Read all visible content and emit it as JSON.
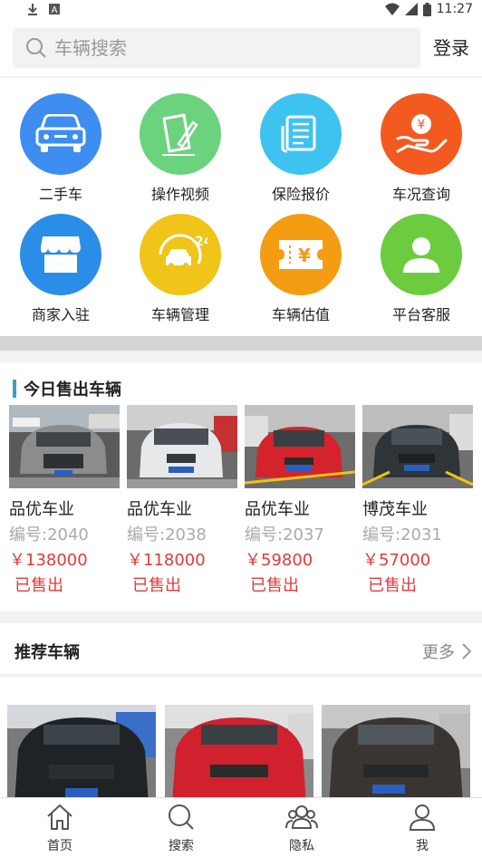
{
  "status_bar": {
    "time": "11:27",
    "icons": [
      "download-icon",
      "notification-a-icon",
      "wifi-icon",
      "signal-icon",
      "battery-icon"
    ]
  },
  "search": {
    "placeholder": "车辆搜索",
    "login_label": "登录"
  },
  "grid": [
    {
      "label": "二手车",
      "icon": "car-front-icon",
      "color": "#3d8ef0"
    },
    {
      "label": "操作视频",
      "icon": "document-pen-icon",
      "color": "#6bd37e"
    },
    {
      "label": "保险报价",
      "icon": "newspaper-icon",
      "color": "#3ec3f0"
    },
    {
      "label": "车况查询",
      "icon": "hand-coin-icon",
      "color": "#f35a1f"
    },
    {
      "label": "商家入驻",
      "icon": "shop-icon",
      "color": "#2a8de8"
    },
    {
      "label": "车辆管理",
      "icon": "car-24-icon",
      "color": "#f0c419"
    },
    {
      "label": "车辆估值",
      "icon": "ticket-yen-icon",
      "color": "#f49c12"
    },
    {
      "label": "平台客服",
      "icon": "user-icon",
      "color": "#6ccb3f"
    }
  ],
  "sold_section": {
    "title": "今日售出车辆",
    "cars": [
      {
        "dealer": "品优车业",
        "code": "编号:2040",
        "price": "￥138000",
        "status": "已售出"
      },
      {
        "dealer": "品优车业",
        "code": "编号:2038",
        "price": "￥118000",
        "status": "已售出"
      },
      {
        "dealer": "品优车业",
        "code": "编号:2037",
        "price": "￥59800",
        "status": "已售出"
      },
      {
        "dealer": "博茂车业",
        "code": "编号:2031",
        "price": "￥57000",
        "status": "已售出"
      }
    ]
  },
  "recommend": {
    "title": "推荐车辆",
    "more_label": "更多"
  },
  "nav": [
    {
      "label": "首页",
      "icon": "home-icon"
    },
    {
      "label": "搜索",
      "icon": "search-icon"
    },
    {
      "label": "隐私",
      "icon": "people-icon"
    },
    {
      "label": "我",
      "icon": "person-icon"
    }
  ]
}
